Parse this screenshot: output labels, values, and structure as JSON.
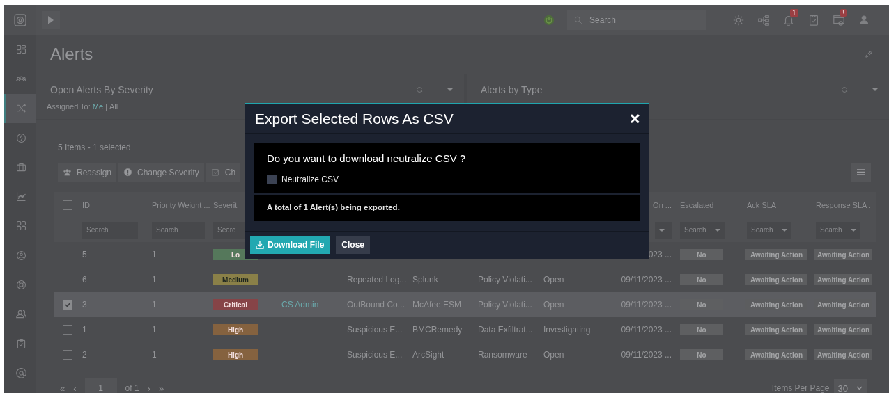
{
  "sidebar": {
    "items": [
      {
        "selected": false
      },
      {
        "selected": false
      },
      {
        "selected": true
      },
      {
        "selected": false
      },
      {
        "selected": false
      },
      {
        "selected": false
      },
      {
        "selected": false
      },
      {
        "selected": false
      },
      {
        "selected": false
      },
      {
        "selected": false
      },
      {
        "selected": false
      },
      {
        "selected": false
      }
    ]
  },
  "topbar": {
    "search": {
      "placeholder": "Search"
    },
    "badges": [
      "1",
      "!"
    ]
  },
  "page": {
    "title": "Alerts"
  },
  "widgets": [
    {
      "title": "Open Alerts By Severity"
    },
    {
      "title": "Alerts by Type"
    }
  ],
  "assigned": {
    "label": "Assigned To:",
    "options": [
      {
        "label": "Me",
        "selected": true
      },
      {
        "label": "All",
        "selected": false
      }
    ],
    "separator": "|"
  },
  "grid": {
    "summary": "5 Items - 1 selected",
    "actions": [
      "Reassign",
      "Change Severity",
      "Ch"
    ],
    "select_all_checked": false,
    "columns": {
      "id": "ID",
      "priority_weight": "Priority Weight ...",
      "severity": "Severit",
      "column_9": "On ...",
      "escalated": "Escalated",
      "ack_sla": "Ack SLA",
      "response_sla": "Response SLA ."
    },
    "filters": {
      "id": {
        "placeholder": "Search",
        "caret": false
      },
      "priority_weight": {
        "placeholder": "Search",
        "caret": false
      },
      "severity": {
        "placeholder": "Searc"
      },
      "column_9": {
        "caret": true
      },
      "escalated": {
        "placeholder": "Search",
        "caret": true
      },
      "ack_sla": {
        "placeholder": "Search",
        "caret": true
      },
      "response_sla": {
        "placeholder": "Search",
        "caret": true
      }
    },
    "rows": [
      {
        "checked": false,
        "selected": false,
        "id": "5",
        "priority_weight": "1",
        "severity": {
          "label": "Lo",
          "color": "#55785b"
        },
        "column_9": "023 ...",
        "escalated": "No",
        "ack_sla": "Awaiting Action",
        "response_sla": "Awaiting Action"
      },
      {
        "checked": false,
        "selected": false,
        "id": "6",
        "priority_weight": "1",
        "severity": {
          "label": "Medium",
          "color": "#8a8048"
        },
        "column_5": "Repeated Log...",
        "column_6": "Splunk",
        "column_7": "Policy Violati...",
        "column_8": "Open",
        "column_9": "09/11/2023 ...",
        "escalated": "No",
        "ack_sla": "Awaiting Action",
        "response_sla": "Awaiting Action"
      },
      {
        "checked": true,
        "selected": true,
        "id": "3",
        "priority_weight": "1",
        "severity": {
          "label": "Critical",
          "color": "#864447"
        },
        "column_4": "CS Admin",
        "column_5": "OutBound Co...",
        "column_6": "McAfee ESM",
        "column_7": "Policy Violati...",
        "column_8": "Open",
        "column_9": "09/11/2023 ...",
        "escalated": "No",
        "ack_sla": "Awaiting Action",
        "response_sla": "Awaiting Action"
      },
      {
        "checked": false,
        "selected": false,
        "id": "1",
        "priority_weight": "1",
        "severity": {
          "label": "High",
          "color": "#85623f"
        },
        "column_5": "Suspicious E...",
        "column_6": "BMCRemedy",
        "column_7": "Data Exfiltrat...",
        "column_8": "Investigating",
        "column_9": "09/11/2023 ...",
        "escalated": "No",
        "ack_sla": "Awaiting Action",
        "response_sla": "Awaiting Action"
      },
      {
        "checked": false,
        "selected": false,
        "id": "2",
        "priority_weight": "1",
        "severity": {
          "label": "High",
          "color": "#85623f"
        },
        "column_5": "Suspicious E...",
        "column_6": "ArcSight",
        "column_7": "Ransomware",
        "column_8": "Open",
        "column_9": "09/11/2023 ...",
        "escalated": "No",
        "ack_sla": "Awaiting Action",
        "response_sla": "Awaiting Action"
      }
    ],
    "pagination": {
      "first": "«",
      "prev": "‹",
      "page": "1",
      "of": "of 1",
      "next": "›",
      "last": "»",
      "per_page_label": "Items Per Page",
      "per_page": "30"
    }
  },
  "modal": {
    "title": "Export Selected Rows As CSV",
    "close": "✕",
    "question": "Do you want to download neutralize CSV ?",
    "checkbox": {
      "label": "Neutralize CSV",
      "checked": false
    },
    "note": "A total of 1 Alert(s) being exported.",
    "buttons": [
      {
        "label": "Download File",
        "kind": "primary"
      },
      {
        "label": "Close",
        "kind": "secondary"
      }
    ]
  }
}
